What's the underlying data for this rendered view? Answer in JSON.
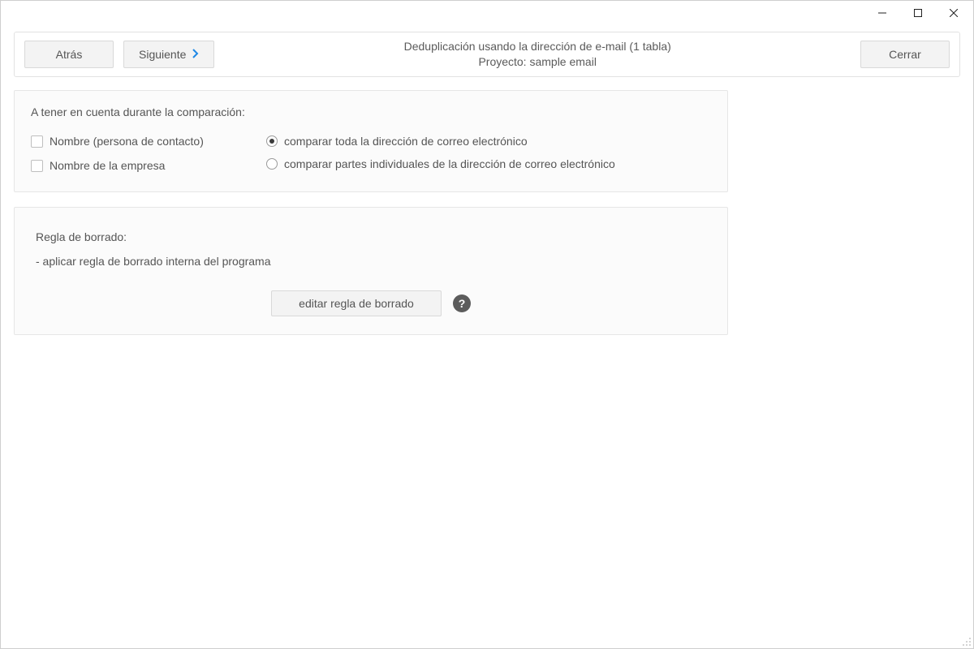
{
  "window": {
    "title_line1": "Deduplicación usando la dirección de e-mail (1 tabla)",
    "title_line2": "Proyecto: sample email",
    "buttons": {
      "back": "Atrás",
      "next": "Siguiente",
      "close": "Cerrar"
    }
  },
  "comparison_panel": {
    "title": "A tener en cuenta durante la comparación:",
    "checkboxes": {
      "name_contact": "Nombre (persona de contacto)",
      "company_name": "Nombre de la empresa"
    },
    "radios": {
      "full_email": "comparar toda la dirección de correo electrónico",
      "parts_email": "comparar partes individuales de la dirección de correo electrónico"
    },
    "checked_states": {
      "name_contact": false,
      "company_name": false,
      "radio_selected": "full_email"
    }
  },
  "delete_rule_panel": {
    "title": "Regla de borrado:",
    "rule_line": "- aplicar regla de borrado interna del programa",
    "edit_button": "editar regla de borrado",
    "help_symbol": "?"
  }
}
